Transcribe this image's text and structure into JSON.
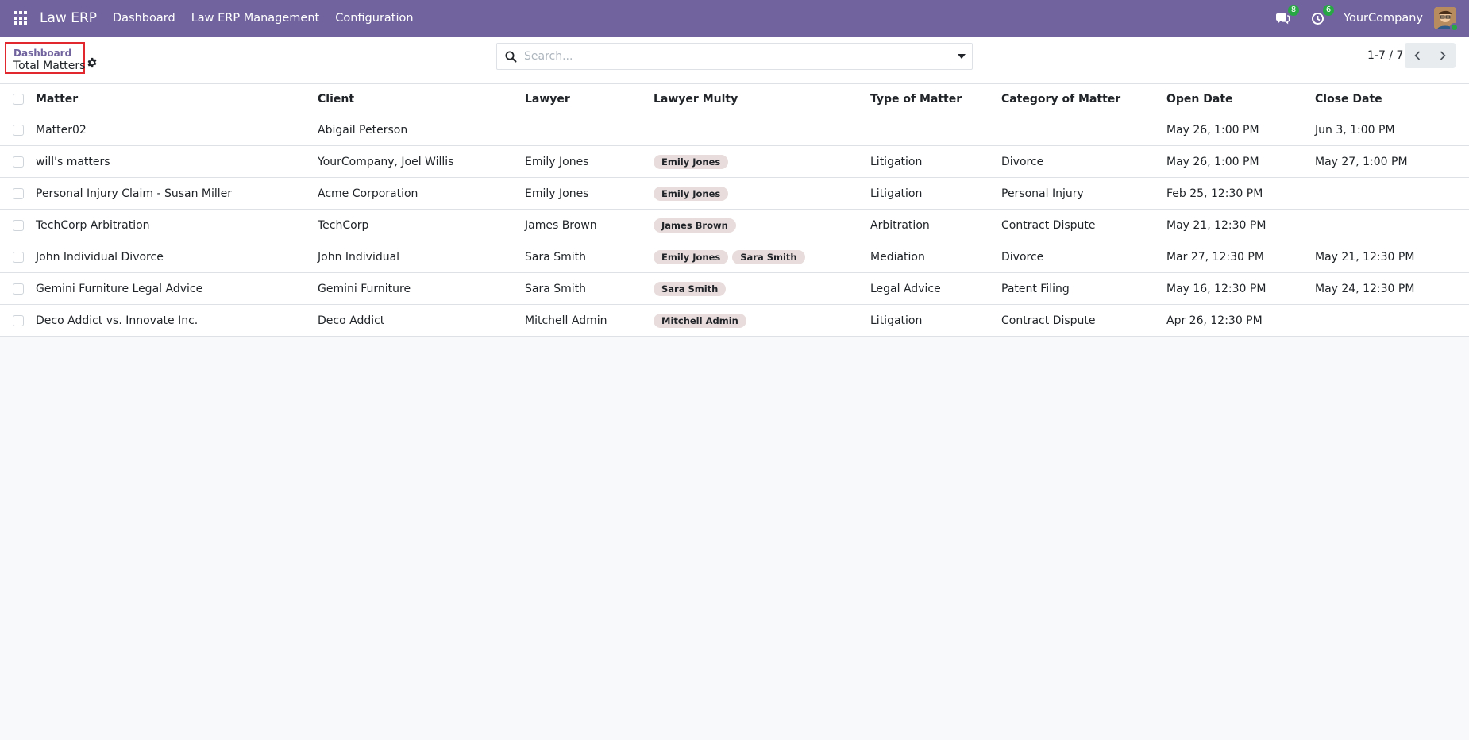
{
  "navbar": {
    "brand": "Law ERP",
    "menu": [
      "Dashboard",
      "Law ERP Management",
      "Configuration"
    ],
    "messages_count": "8",
    "activities_count": "6",
    "company": "YourCompany"
  },
  "breadcrumb": {
    "parent": "Dashboard",
    "current": "Total Matters"
  },
  "search": {
    "placeholder": "Search...",
    "value": ""
  },
  "pager": {
    "value": "1-7 / 7"
  },
  "table": {
    "columns": [
      "Matter",
      "Client",
      "Lawyer",
      "Lawyer Multy",
      "Type of Matter",
      "Category of Matter",
      "Open Date",
      "Close Date"
    ],
    "rows": [
      {
        "matter": "Matter02",
        "client": "Abigail Peterson",
        "lawyer": "",
        "lawyers": [],
        "type": "",
        "category": "",
        "open": "May 26, 1:00 PM",
        "close": "Jun 3, 1:00 PM"
      },
      {
        "matter": "will's matters",
        "client": "YourCompany, Joel Willis",
        "lawyer": "Emily Jones",
        "lawyers": [
          "Emily Jones"
        ],
        "type": "Litigation",
        "category": "Divorce",
        "open": "May 26, 1:00 PM",
        "close": "May 27, 1:00 PM"
      },
      {
        "matter": "Personal Injury Claim - Susan Miller",
        "client": "Acme Corporation",
        "lawyer": "Emily Jones",
        "lawyers": [
          "Emily Jones"
        ],
        "type": "Litigation",
        "category": "Personal Injury",
        "open": "Feb 25, 12:30 PM",
        "close": ""
      },
      {
        "matter": "TechCorp Arbitration",
        "client": "TechCorp",
        "lawyer": "James Brown",
        "lawyers": [
          "James Brown"
        ],
        "type": "Arbitration",
        "category": "Contract Dispute",
        "open": "May 21, 12:30 PM",
        "close": ""
      },
      {
        "matter": "John Individual Divorce",
        "client": "John Individual",
        "lawyer": "Sara Smith",
        "lawyers": [
          "Emily Jones",
          "Sara Smith"
        ],
        "type": "Mediation",
        "category": "Divorce",
        "open": "Mar 27, 12:30 PM",
        "close": "May 21, 12:30 PM"
      },
      {
        "matter": "Gemini Furniture Legal Advice",
        "client": "Gemini Furniture",
        "lawyer": "Sara Smith",
        "lawyers": [
          "Sara Smith"
        ],
        "type": "Legal Advice",
        "category": "Patent Filing",
        "open": "May 16, 12:30 PM",
        "close": "May 24, 12:30 PM"
      },
      {
        "matter": "Deco Addict vs. Innovate Inc.",
        "client": "Deco Addict",
        "lawyer": "Mitchell Admin",
        "lawyers": [
          "Mitchell Admin"
        ],
        "type": "Litigation",
        "category": "Contract Dispute",
        "open": "Apr 26, 12:30 PM",
        "close": ""
      }
    ]
  },
  "colors": {
    "navbar": "#71639e",
    "accent": "#71639e",
    "badge": "#28a745",
    "tag_bg": "#e8dcdc",
    "highlight_border": "#e0282e"
  },
  "icons": {
    "apps": "grid-icon",
    "messages": "chat-icon",
    "activities": "clock-icon",
    "search": "search-icon",
    "settings": "gear-icon"
  }
}
